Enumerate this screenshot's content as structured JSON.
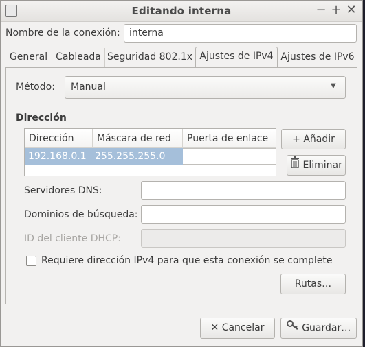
{
  "window": {
    "title": "Editando interna"
  },
  "connection": {
    "name_label": "Nombre de la conexión:",
    "name_value": "interna"
  },
  "tabs": [
    {
      "label": "General"
    },
    {
      "label": "Cableada"
    },
    {
      "label": "Seguridad 802.1x"
    },
    {
      "label": "Ajustes de IPv4",
      "active": true
    },
    {
      "label": "Ajustes de IPv6"
    }
  ],
  "method": {
    "label": "Método:",
    "value": "Manual"
  },
  "addresses": {
    "section_title": "Dirección",
    "columns": [
      "Dirección",
      "Máscara de red",
      "Puerta de enlace"
    ],
    "rows": [
      {
        "address": "192.168.0.1",
        "netmask": "255.255.255.0",
        "gateway": ""
      }
    ],
    "add_label": "Añadir",
    "remove_label": "Eliminar"
  },
  "dns": {
    "label": "Servidores DNS:",
    "value": ""
  },
  "search_domains": {
    "label": "Dominios de búsqueda:",
    "value": ""
  },
  "dhcp_client_id": {
    "label": "ID del cliente DHCP:",
    "value": ""
  },
  "require_ipv4": {
    "label": "Requiere dirección IPv4 para que esta conexión se complete",
    "checked": false
  },
  "routes_label": "Rutas…",
  "footer": {
    "cancel_label": "Cancelar",
    "save_label": "Guardar…"
  },
  "colors": {
    "selection": "#a5bfda",
    "window_bg": "#f2f1f0"
  }
}
